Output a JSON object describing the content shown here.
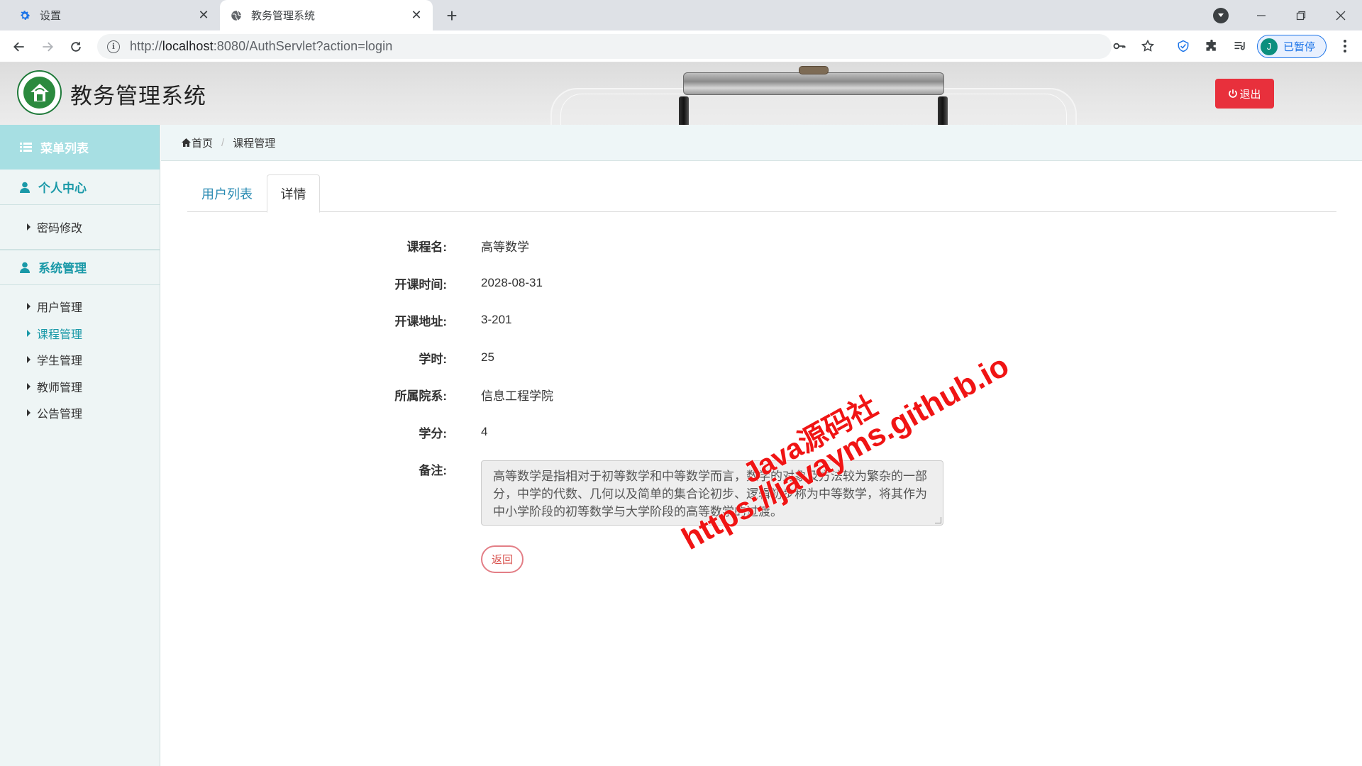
{
  "browser": {
    "tabs": [
      {
        "title": "设置",
        "icon": "gear-icon",
        "active": false
      },
      {
        "title": "教务管理系统",
        "icon": "globe-icon",
        "active": true
      }
    ],
    "url_prefix": "http://",
    "url_host": "localhost",
    "url_rest": ":8080/AuthServlet?action=login",
    "profile_initial": "J",
    "profile_label": "已暂停"
  },
  "app": {
    "title": "教务管理系统",
    "logout_label": "退出"
  },
  "sidebar": {
    "menu_title": "菜单列表",
    "groups": [
      {
        "title": "个人中心",
        "items": [
          {
            "label": "密码修改",
            "active": false
          }
        ]
      },
      {
        "title": "系统管理",
        "items": [
          {
            "label": "用户管理",
            "active": false
          },
          {
            "label": "课程管理",
            "active": true
          },
          {
            "label": "学生管理",
            "active": false
          },
          {
            "label": "教师管理",
            "active": false
          },
          {
            "label": "公告管理",
            "active": false
          }
        ]
      }
    ]
  },
  "breadcrumb": {
    "home": "首页",
    "current": "课程管理"
  },
  "tabs": [
    {
      "label": "用户列表",
      "active": false
    },
    {
      "label": "详情",
      "active": true
    }
  ],
  "detail": {
    "fields": [
      {
        "label": "课程名:",
        "value": "高等数学"
      },
      {
        "label": "开课时间:",
        "value": "2028-08-31"
      },
      {
        "label": "开课地址:",
        "value": "3-201"
      },
      {
        "label": "学时:",
        "value": "25"
      },
      {
        "label": "所属院系:",
        "value": "信息工程学院"
      },
      {
        "label": "学分:",
        "value": "4"
      }
    ],
    "remark_label": "备注:",
    "remark_value": "高等数学是指相对于初等数学和中等数学而言，数学的对象及方法较为繁杂的一部分，中学的代数、几何以及简单的集合论初步、逻辑初步称为中等数学，将其作为中小学阶段的初等数学与大学阶段的高等数学的过渡。",
    "back_label": "返回"
  },
  "watermark": {
    "line1": "Java源码社",
    "line2": "https://javayms.github.io"
  },
  "colors": {
    "accent": "#1a99a8",
    "danger": "#e8303c",
    "link": "#2a8bb3"
  }
}
